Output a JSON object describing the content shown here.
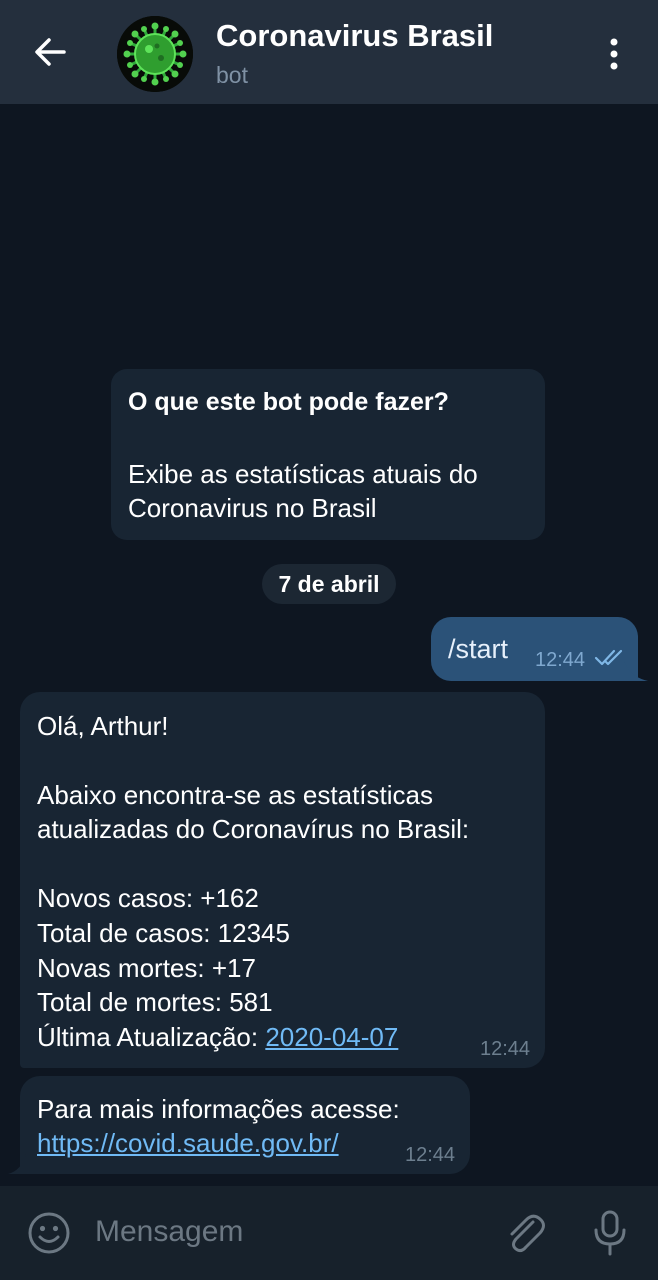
{
  "header": {
    "title": "Coronavirus Brasil",
    "subtitle": "bot",
    "icons": [
      "back-arrow-icon",
      "coronavirus-avatar",
      "more-vertical-icon"
    ]
  },
  "info_card": {
    "title": "O que este bot pode fazer?",
    "description_lines": [
      "Exibe as estatísticas atuais do",
      "Coronavirus no Brasil"
    ]
  },
  "date_separator": "7 de abril",
  "messages": [
    {
      "direction": "outgoing",
      "text": "/start",
      "time": "12:44",
      "status_icon": "double-check-icon"
    },
    {
      "direction": "incoming",
      "greeting": "Olá, Arthur!",
      "intro_lines": [
        "Abaixo encontra-se as estatísticas",
        "atualizadas do Coronavírus no Brasil:"
      ],
      "stats": [
        "Novos casos: +162",
        "Total de casos: 12345",
        "Novas mortes: +17",
        "Total de mortes: 581"
      ],
      "update_label": "Última Atualização: ",
      "update_date": "2020-04-07",
      "time": "12:44"
    },
    {
      "direction": "incoming",
      "text": "Para mais informações acesse:",
      "link": "https://covid.saude.gov.br/",
      "time": "12:44"
    }
  ],
  "composer": {
    "placeholder": "Mensagem",
    "icons": [
      "emoji-icon",
      "attach-icon",
      "microphone-icon"
    ]
  },
  "colors": {
    "background": "#0e1621",
    "header": "#242f3d",
    "incoming_bubble": "#182533",
    "outgoing_bubble": "#2b5278",
    "link": "#70baf5",
    "composer": "#17212b"
  }
}
